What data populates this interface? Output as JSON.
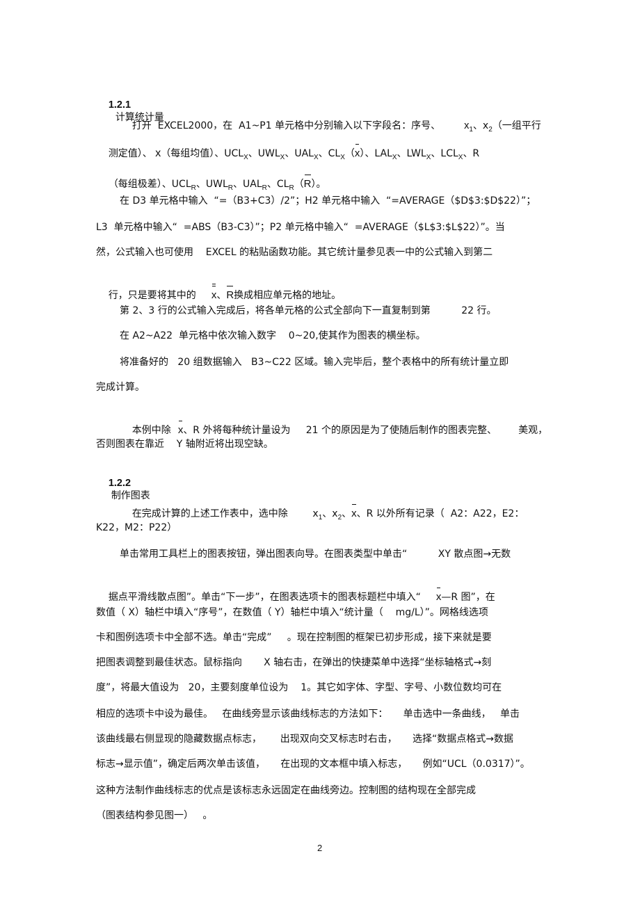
{
  "page_number": "2",
  "section_1": {
    "number": "1.2.1",
    "title": "计算统计量"
  },
  "section_2": {
    "number": "1.2.2",
    "title": "制作图表"
  },
  "lines": {
    "l1a": "打开  EXCEL2000，在  A1~P1 单元格中分别输入以下字段名：序号、",
    "l1b": "x",
    "l1b_sub": "1",
    "l1c": "、x",
    "l1c_sub": "2",
    "l1d": "（一组平行",
    "l2a": "测定值）、",
    "l2b": "x",
    "l2c": "（每组均值）、UCL",
    "sub_x": "X",
    "l2d": "、UWL",
    "l2e": "、UAL",
    "l2f": "、CL",
    "l2g": "（",
    "l2h": "x",
    "l2i": "）、LAL",
    "l2j": "、LWL",
    "l2k": "、LCL",
    "l2l": "、R",
    "l3a": "（每组极差）、UCL",
    "sub_r": "R",
    "l3b": "、UWL",
    "l3c": "、UAL",
    "l3d": "、CL",
    "l3e": "（",
    "l3f": "R",
    "l3g": "）。",
    "l4": "在 D3 单元格中输入  “=（B3+C3）/2”；H2 单元格中输入  “=AVERAGE（$D$3:$D$22）”；",
    "l5": "L3  单元格中输入“  =ABS（B3-C3）”；P2 单元格中输入“  =AVERAGE（$L$3:$L$22）”。当",
    "l6": "然，公式输入也可使用    EXCEL 的粘贴函数功能。其它统计量参见表一中的公式输入到第二",
    "l7a": "行，只是要将其中的",
    "l7b": "x",
    "l7c": "、",
    "l7d": "R",
    "l7e": "换成相应单元格的地址。",
    "l8": "第 2、3 行的公式输入完成后，将各单元格的公式全部向下一直复制到第          22 行。",
    "l9": "在 A2~A22  单元格中依次输入数字    0~20,使其作为图表的横坐标。",
    "l10": "将准备好的   20 组数据输入   B3~C22 区域。输入完毕后，整个表格中的所有统计量立即",
    "l11": "完成计算。",
    "l12a": "本例中除",
    "l12b": "x",
    "l12c": "、R 外将每种统计量设为     21 个的原因是为了使随后制作的图表完整、       美观，",
    "l13": "否则图表在靠近    Y 轴附近将出现空缺。",
    "l14a": "在完成计算的上述工作表中，选中除        x",
    "l14b": "1",
    "l14c": "、x",
    "l14d": "2",
    "l14e": "、",
    "l14f": "x",
    "l14g": "、R 以外所有记录（  A2：A22，E2：",
    "l15": "K22，M2：P22）",
    "l16": "单击常用工具栏上的图表按钮，弹出图表向导。在图表类型中单击“          XY 散点图→无数",
    "l17a": "据点平滑线散点图”。单击“下一步”，在图表选项卡的图表标题栏中填入“",
    "l17b": "x",
    "l17c": "—R 图”，在",
    "l18": "数值（ X）轴栏中填入“序号”，在数值（ Y）轴栏中填入“统计量（    mg/L）”。网格线选项",
    "l19": "卡和图例选项卡中全部不选。单击“完成”     。现在控制图的框架已初步形成，接下来就是要",
    "l20": "把图表调整到最佳状态。鼠标指向       X 轴右击，在弹出的快捷菜单中选择“坐标轴格式→刻",
    "l21": "度”，将最大值设为   20，主要刻度单位设为    1。其它如字体、字型、字号、小数位数均可在",
    "l22": "相应的选项卡中设为最佳。   在曲线旁显示该曲线标志的方法如下：     单击选中一条曲线，   单击",
    "l23": "该曲线最右侧显现的隐藏数据点标志，      出现双向交叉标志时右击，     选择“数据点格式→数据",
    "l24": "标志→显示值”，确定后两次单击该值，     在出现的文本框中填入标志，     例如“UCL（0.0317）”。",
    "l25": "这种方法制作曲线标志的优点是该标志永远固定在曲线旁边。控制图的结构现在全部完成",
    "l26": "（图表结构参见图一）   。"
  }
}
